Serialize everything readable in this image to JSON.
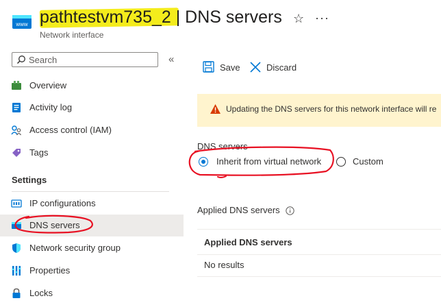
{
  "header": {
    "title": "pathtestvm735_2 | DNS servers",
    "subtitle": "Network interface",
    "resource_icon": "network-interface-icon",
    "redaction_color": "#f4ec1c"
  },
  "sidebar": {
    "search_placeholder": "Search",
    "items": [
      {
        "label": "Overview",
        "icon": "overview-icon"
      },
      {
        "label": "Activity log",
        "icon": "activity-log-icon"
      },
      {
        "label": "Access control (IAM)",
        "icon": "people-icon"
      },
      {
        "label": "Tags",
        "icon": "tag-icon"
      }
    ],
    "settings_header": "Settings",
    "settings_items": [
      {
        "label": "IP configurations",
        "icon": "ip-config-icon"
      },
      {
        "label": "DNS servers",
        "icon": "dns-icon",
        "selected": true
      },
      {
        "label": "Network security group",
        "icon": "shield-icon"
      },
      {
        "label": "Properties",
        "icon": "properties-icon"
      },
      {
        "label": "Locks",
        "icon": "lock-icon"
      }
    ]
  },
  "toolbar": {
    "save_label": "Save",
    "discard_label": "Discard"
  },
  "banner": {
    "text": "Updating the DNS servers for this network interface will re",
    "icon": "warning-icon"
  },
  "dns": {
    "field_label": "DNS servers",
    "options": [
      {
        "label": "Inherit from virtual network",
        "checked": true
      },
      {
        "label": "Custom",
        "checked": false
      }
    ]
  },
  "applied": {
    "label": "Applied DNS servers",
    "table_header": "Applied DNS servers",
    "empty_text": "No results"
  },
  "colors": {
    "accent": "#0078d4",
    "annotation": "#e81123",
    "warning": "#d83b01"
  }
}
